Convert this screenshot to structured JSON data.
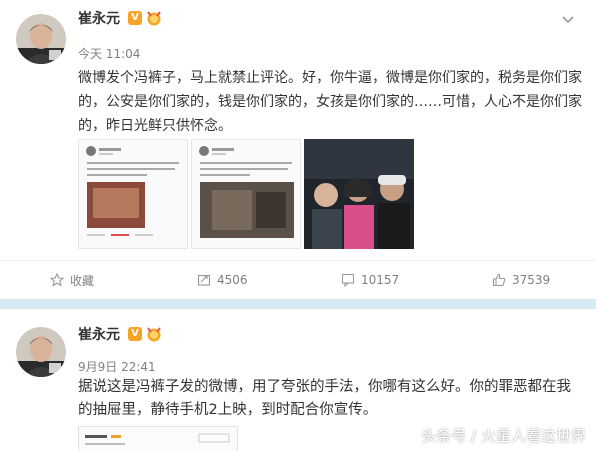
{
  "post1": {
    "user_name": "崔永元",
    "time": "今天 11:04",
    "text": "微博发个冯裤子，马上就禁止评论。好，你牛逼，微博是你们家的，税务是你们家的，公安是你们家的，钱是你们家的，女孩是你们家的……可惜，人心不是你们家的，昨日光鲜只供怀念。",
    "actions": {
      "favorite_label": "收藏",
      "repost_count": "4506",
      "comment_count": "10157",
      "like_count": "37539"
    }
  },
  "post2": {
    "user_name": "崔永元",
    "time": "9月9日 22:41",
    "text": "据说这是冯裤子发的微博，用了夸张的手法，你哪有这么好。你的罪恶都在我的抽屉里，静待手机2上映，到时配合你宣传。"
  },
  "badge": {
    "verified_label": "V"
  },
  "watermark": "头条号 / 火星人看这世界",
  "colors": {
    "separator": "#d6eaf3",
    "verified": "#f7a328",
    "muted_text": "#808080",
    "body_text": "#333333"
  },
  "icons": {
    "more": "chevron-down-icon",
    "favorite": "star-icon",
    "repost": "repost-icon",
    "comment": "comment-icon",
    "like": "thumbs-up-icon"
  }
}
